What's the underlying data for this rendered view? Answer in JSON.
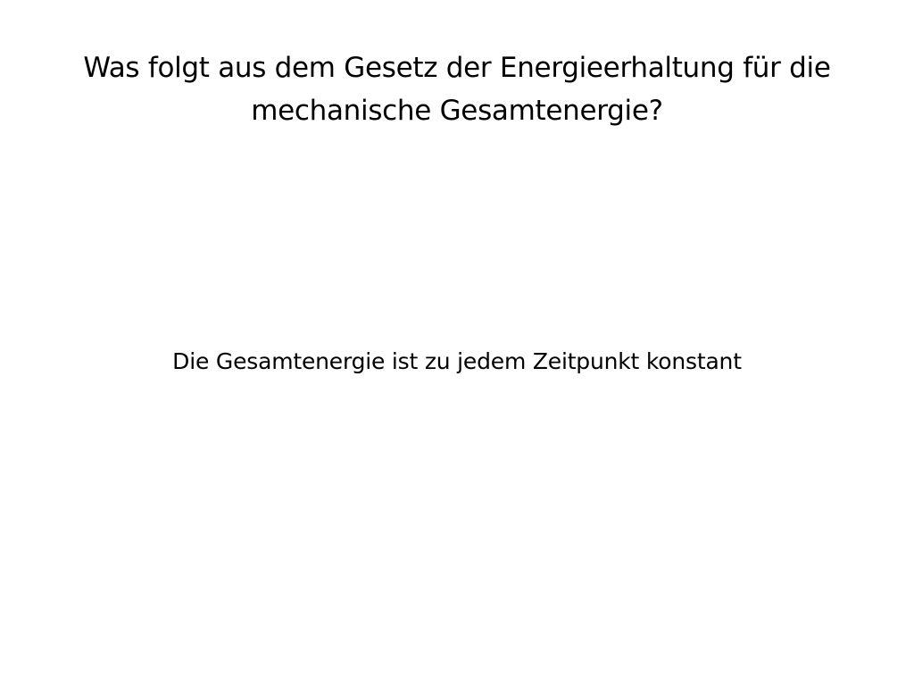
{
  "card": {
    "question": "Was folgt aus dem Gesetz der Energieerhaltung für die mechanische Gesamtenergie?",
    "answer": "Die Gesamtenergie ist zu jedem Zeitpunkt konstant"
  },
  "colors": {
    "background": "#ffffff",
    "text": "#000000"
  }
}
